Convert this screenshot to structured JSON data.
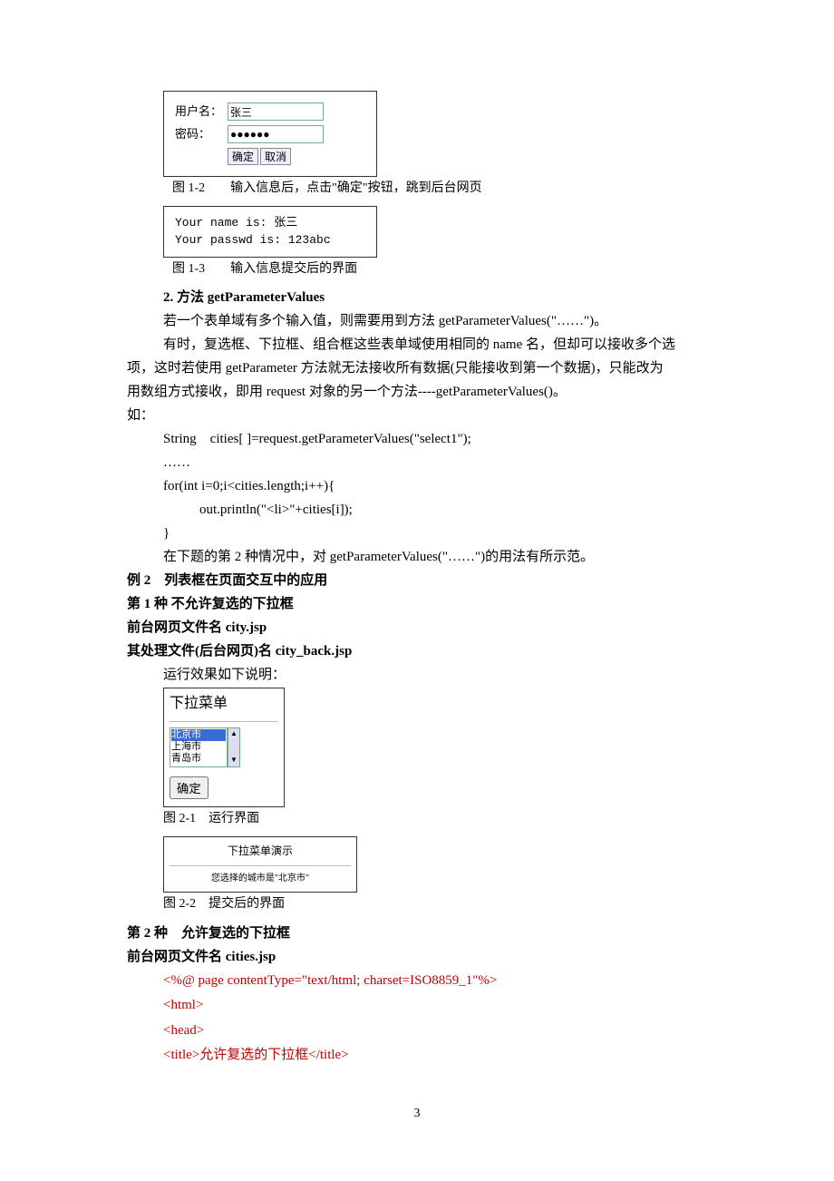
{
  "fig1": {
    "user_label": "用户名：",
    "user_value": "张三",
    "pwd_label": "密码：",
    "pwd_value": "●●●●●●",
    "btn_ok": "确定",
    "btn_cancel": "取消",
    "caption": "图 1-2　　输入信息后，点击\"确定\"按钮，跳到后台网页"
  },
  "fig1b": {
    "line1": "Your name is: 张三",
    "line2": "Your passwd is: 123abc",
    "caption": "图 1-3　　输入信息提交后的界面"
  },
  "h2": "2. 方法 getParameterValues",
  "p1": "若一个表单域有多个输入值，则需要用到方法 getParameterValues(\"……\")。",
  "p2a": "有时，复选框、下拉框、组合框这些表单域使用相同的 name 名，但却可以接收多个选",
  "p2b": "项，这时若使用 getParameter 方法就无法接收所有数据(只能接收到第一个数据)，只能改为",
  "p2c": "用数组方式接收，即用 request 对象的另一个方法----getParameterValues()。",
  "p3": "如：",
  "code1": "String　cities[ ]=request.getParameterValues(\"select1\");",
  "code2": "……",
  "code3": "for(int i=0;i<cities.length;i++){",
  "code4": "out.println(\"<li>\"+cities[i]);",
  "code5": "}",
  "p4": "在下题的第 2 种情况中，对 getParameterValues(\"……\")的用法有所示范。",
  "ex2": "例 2　列表框在页面交互中的应用",
  "kind1": "第 1 种 不允许复选的下拉框",
  "front1": "前台网页文件名 city.jsp",
  "back1": "其处理文件(后台网页)名 city_back.jsp",
  "run_note": "运行效果如下说明：",
  "dd": {
    "title": "下拉菜单",
    "opt1": "北京市",
    "opt2": "上海市",
    "opt3": "青岛市",
    "btn": "确定",
    "caption": "图 2-1　运行界面"
  },
  "res": {
    "title": "下拉菜单演示",
    "text": "您选择的城市是\"北京市\"",
    "caption": "图 2-2　提交后的界面"
  },
  "kind2": "第 2 种　允许复选的下拉框",
  "front2": "前台网页文件名 cities.jsp",
  "src": {
    "l1": "<%@ page contentType=\"text/html; charset=ISO8859_1\"%>",
    "l2": "<html>",
    "l3": "<head>",
    "l4": "<title>允许复选的下拉框</title>"
  },
  "page_no": "3"
}
